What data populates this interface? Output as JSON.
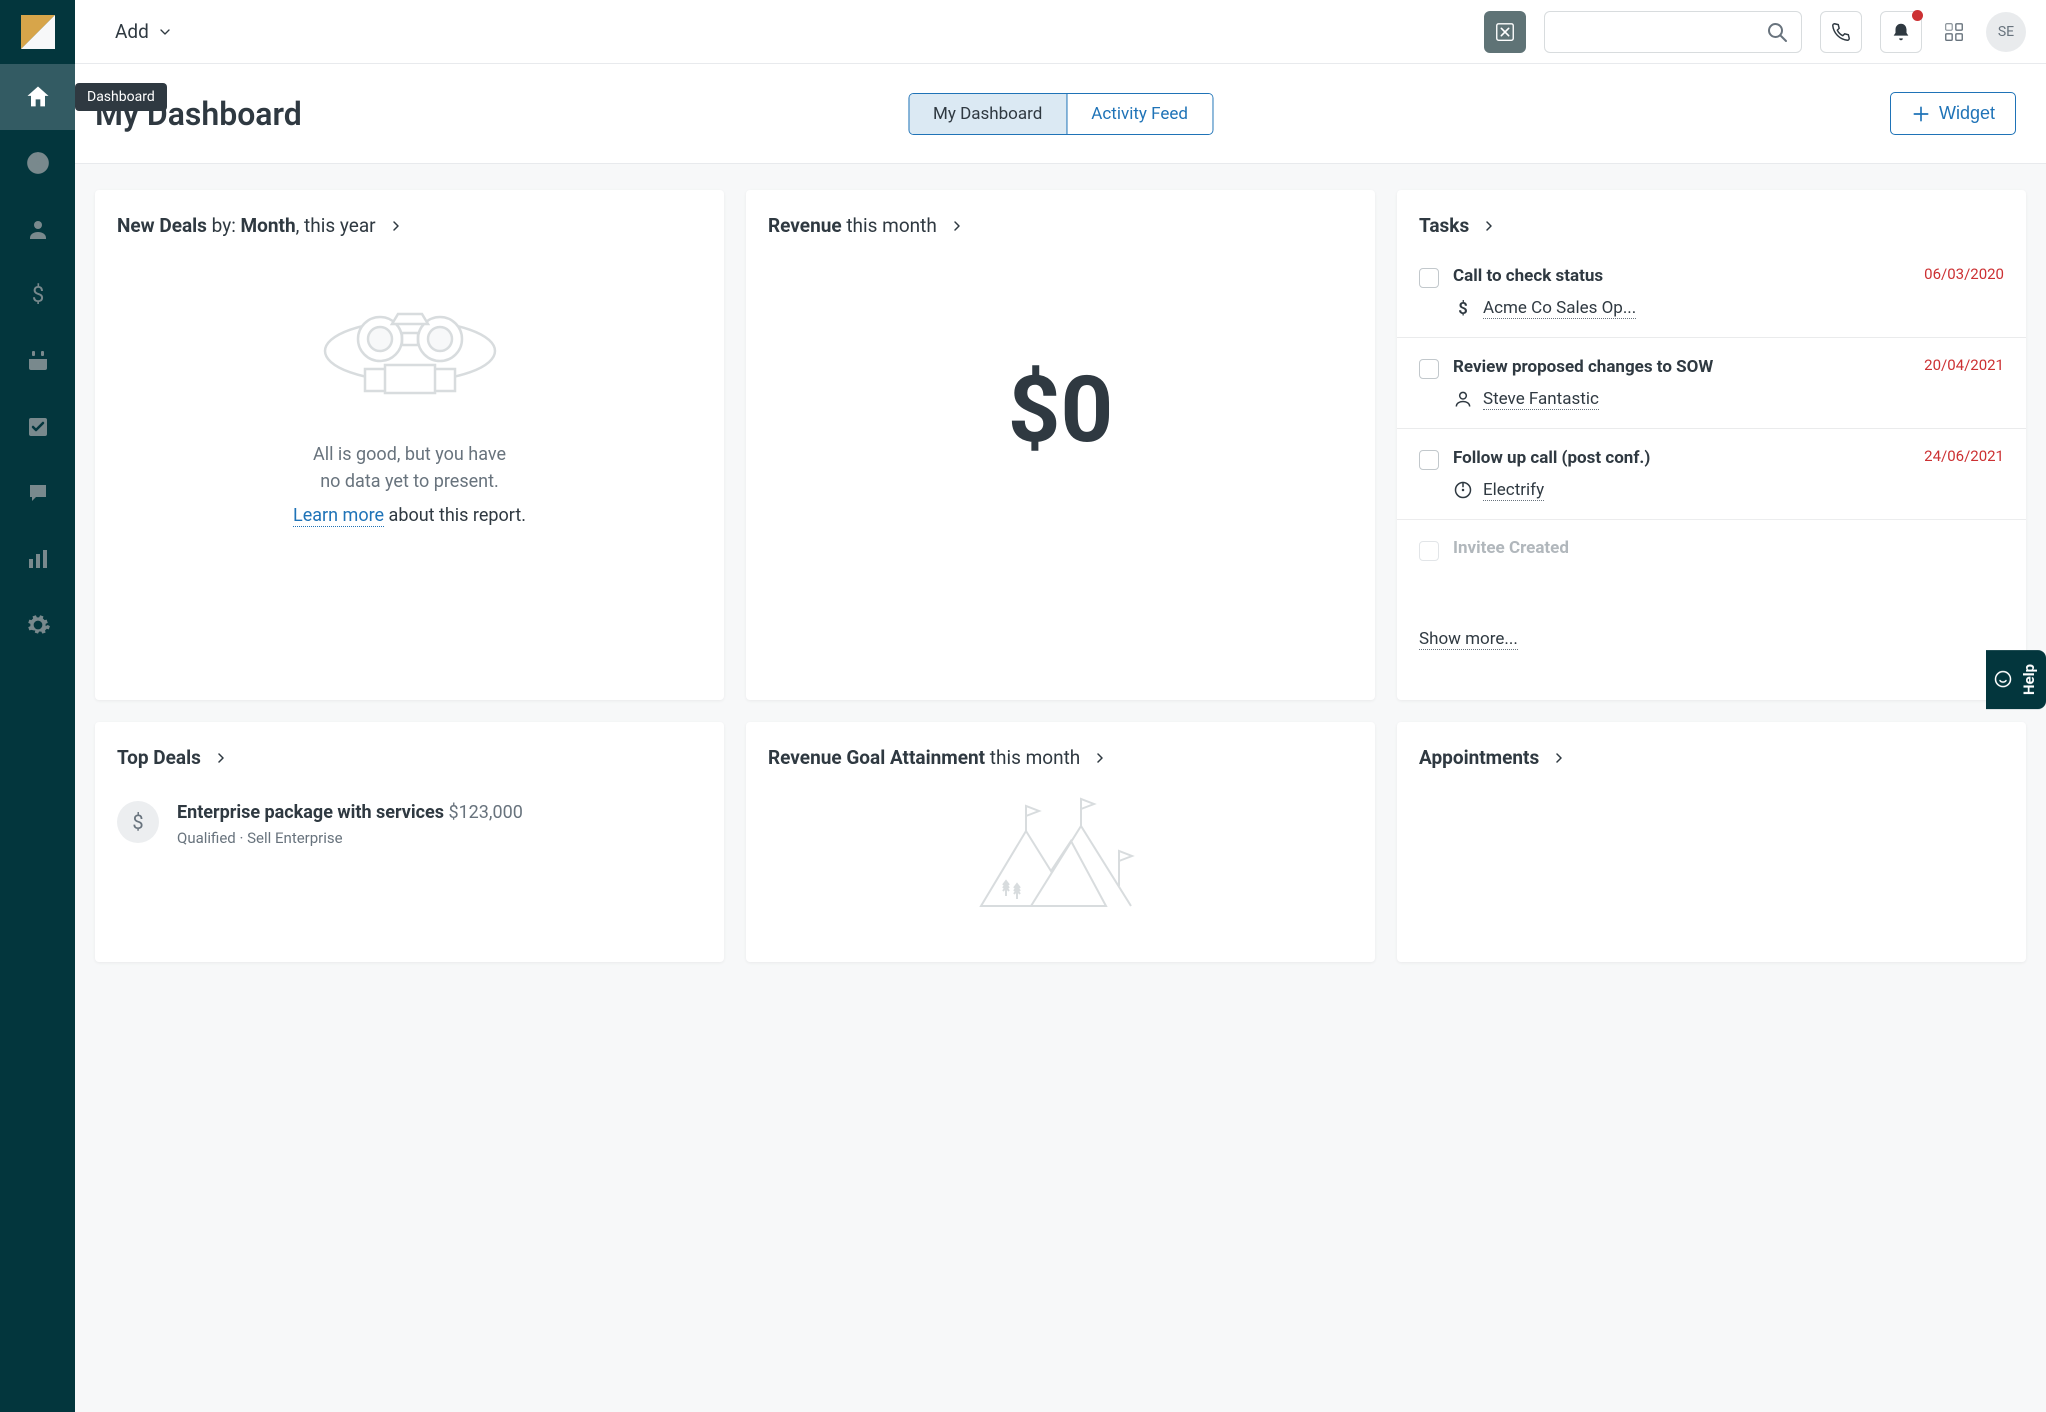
{
  "topbar": {
    "add_label": "Add",
    "avatar_initials": "SE"
  },
  "sidebar": {
    "active_tooltip": "Dashboard"
  },
  "header": {
    "title": "My Dashboard",
    "tabs": {
      "dashboard": "My Dashboard",
      "feed": "Activity Feed"
    },
    "widget_label": "Widget"
  },
  "widgets": {
    "new_deals": {
      "title_strong1": "New Deals",
      "title_mid": " by: ",
      "title_strong2": "Month",
      "title_tail": ", this year",
      "empty_line1": "All is good, but you have",
      "empty_line2": "no data yet to present.",
      "learn_link": "Learn more",
      "learn_tail": " about this report."
    },
    "revenue": {
      "title_strong": "Revenue",
      "title_tail": " this month",
      "value": "$0"
    },
    "tasks": {
      "title": "Tasks",
      "show_more": "Show more...",
      "items": [
        {
          "title": "Call to check status",
          "date": "06/03/2020",
          "link": "Acme Co Sales Op...",
          "link_type": "deal"
        },
        {
          "title": "Review proposed changes to SOW",
          "date": "20/04/2021",
          "link": "Steve Fantastic",
          "link_type": "person"
        },
        {
          "title": "Follow up call (post conf.)",
          "date": "24/06/2021",
          "link": "Electrify",
          "link_type": "lead"
        }
      ],
      "partial_title": "Invitee Created"
    },
    "top_deals": {
      "title": "Top Deals",
      "deal": {
        "title": "Enterprise package with services",
        "amount": "$123,000",
        "sub": "Qualified · Sell Enterprise"
      }
    },
    "revenue_goal": {
      "title_strong": "Revenue Goal Attainment",
      "title_tail": " this month"
    },
    "appointments": {
      "title": "Appointments"
    }
  },
  "help_tab": "Help"
}
